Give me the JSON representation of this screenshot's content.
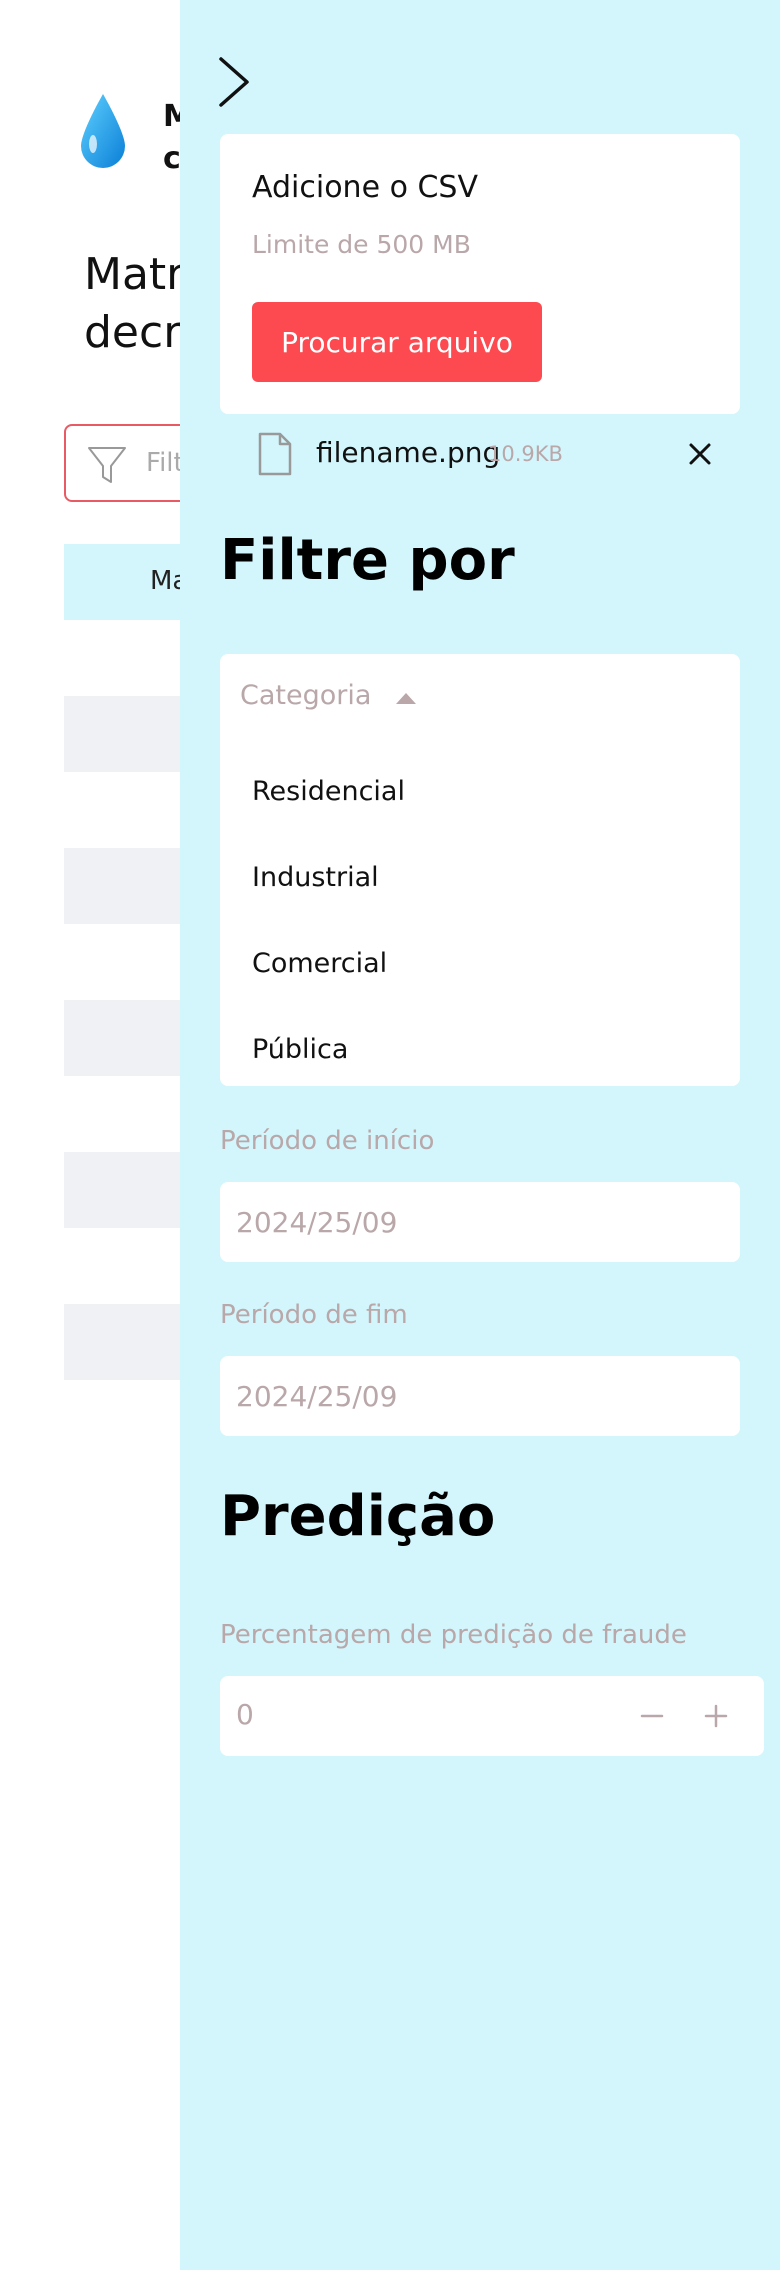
{
  "main": {
    "app_title": "M\nc",
    "page_heading": "Matri\ndecre",
    "filter_placeholder": "Filt",
    "table_header_cell": "Ma",
    "row_count": 5
  },
  "panel": {
    "upload": {
      "title": "Adicione o CSV",
      "limit": "Limite de 500 MB",
      "browse_label": "Procurar arquivo"
    },
    "file": {
      "name": "filename.png",
      "size": "10.9KB"
    },
    "filter_title": "Filtre por",
    "category": {
      "placeholder": "Categoria",
      "options": [
        "Residencial",
        "Industrial",
        "Comercial",
        "Pública"
      ]
    },
    "start_period": {
      "label": "Período de início",
      "value": "2024/25/09"
    },
    "end_period": {
      "label": "Período de fim",
      "value": "2024/25/09"
    },
    "prediction_title": "Predição",
    "prediction": {
      "label": "Percentagem de predição de fraude",
      "value": "0"
    }
  },
  "colors": {
    "panel_bg": "#d2f6fc",
    "primary_button": "#fc4a50",
    "muted_text": "#b9a7a9",
    "filter_border": "#e85a64",
    "row_stripe": "#f0f1f5"
  },
  "icons": [
    "water-drop-icon",
    "funnel-icon",
    "chevron-right-icon",
    "file-icon",
    "close-icon",
    "caret-up-icon",
    "minus-icon",
    "plus-icon"
  ]
}
